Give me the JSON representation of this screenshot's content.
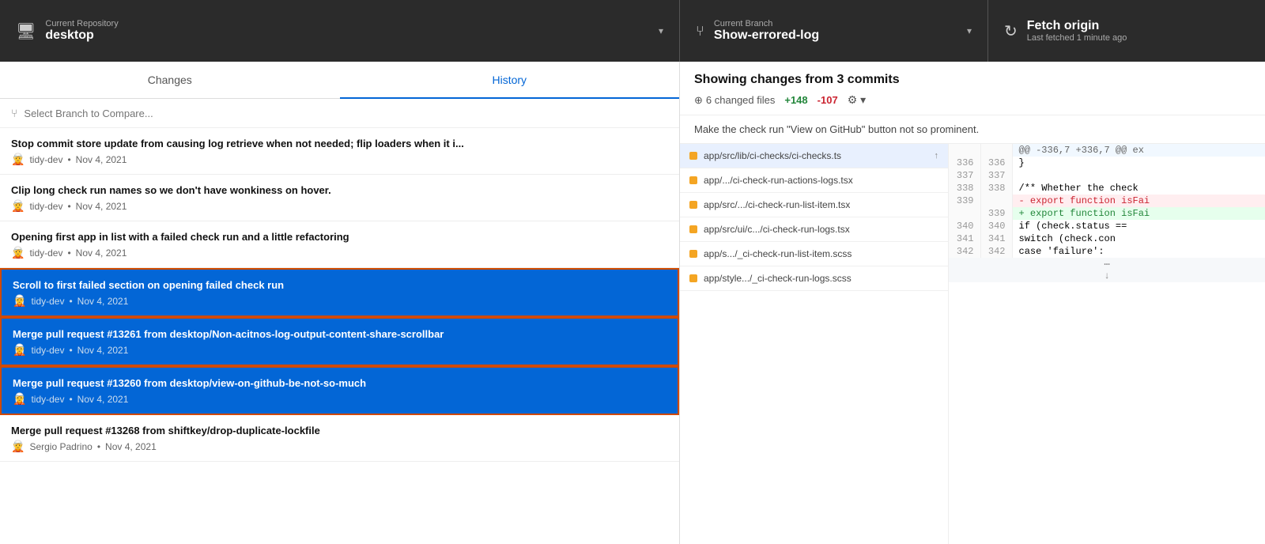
{
  "topBar": {
    "repo": {
      "label": "Current Repository",
      "value": "desktop",
      "icon": "🖥"
    },
    "branch": {
      "label": "Current Branch",
      "value": "Show-errored-log",
      "icon": "⑂"
    },
    "fetch": {
      "label": "Fetch origin",
      "sublabel": "Last fetched 1 minute ago",
      "icon": "↻"
    }
  },
  "tabs": {
    "changes": "Changes",
    "history": "History"
  },
  "branchCompare": {
    "placeholder": "Select Branch to Compare...",
    "icon": "⑂"
  },
  "commits": [
    {
      "id": 1,
      "title": "Stop commit store update from causing log retrieve when not needed; flip loaders when it i...",
      "author": "tidy-dev",
      "date": "Nov 4, 2021",
      "selected": false
    },
    {
      "id": 2,
      "title": "Clip long check run names so we don't have wonkiness on hover.",
      "author": "tidy-dev",
      "date": "Nov 4, 2021",
      "selected": false
    },
    {
      "id": 3,
      "title": "Opening first app in list with a failed check run and a little refactoring",
      "author": "tidy-dev",
      "date": "Nov 4, 2021",
      "selected": false
    },
    {
      "id": 4,
      "title": "Scroll to first failed section on opening failed check run",
      "author": "tidy-dev",
      "date": "Nov 4, 2021",
      "selected": true
    },
    {
      "id": 5,
      "title": "Merge pull request #13261 from desktop/Non-acitnos-log-output-content-share-scrollbar",
      "author": "tidy-dev",
      "date": "Nov 4, 2021",
      "selected": true
    },
    {
      "id": 6,
      "title": "Merge pull request #13260 from desktop/view-on-github-be-not-so-much",
      "author": "tidy-dev",
      "date": "Nov 4, 2021",
      "selected": true
    },
    {
      "id": 7,
      "title": "Merge pull request #13268 from shiftkey/drop-duplicate-lockfile",
      "author": "Sergio Padrino",
      "date": "Nov 4, 2021",
      "selected": false
    }
  ],
  "rightPanel": {
    "title": "Showing changes from 3 commits",
    "changedFiles": "6 changed files",
    "additions": "+148",
    "deletions": "-107",
    "description": "Make the check run \"View on GitHub\" button not so prominent."
  },
  "files": [
    {
      "name": "app/src/lib/ci-checks/ci-checks.ts",
      "active": true,
      "arrow": "↑"
    },
    {
      "name": "app/.../ci-check-run-actions-logs.tsx",
      "active": false
    },
    {
      "name": "app/src/.../ci-check-run-list-item.tsx",
      "active": false
    },
    {
      "name": "app/src/ui/c.../ci-check-run-logs.tsx",
      "active": false
    },
    {
      "name": "app/s.../_ci-check-run-list-item.scss",
      "active": false
    },
    {
      "name": "app/style.../_ci-check-run-logs.scss",
      "active": false
    }
  ],
  "diffLines": [
    {
      "type": "hunk",
      "oldNum": "",
      "newNum": "",
      "content": "@@ -336,7 +336,7 @@ ex"
    },
    {
      "type": "context",
      "oldNum": "336",
      "newNum": "336",
      "content": "  }"
    },
    {
      "type": "context",
      "oldNum": "337",
      "newNum": "337",
      "content": ""
    },
    {
      "type": "context",
      "oldNum": "338",
      "newNum": "338",
      "content": "  /** Whether the check"
    },
    {
      "type": "removed",
      "oldNum": "339",
      "newNum": "",
      "content": "- export function isFai"
    },
    {
      "type": "added",
      "oldNum": "",
      "newNum": "339",
      "content": "+ export function isFai"
    },
    {
      "type": "context",
      "oldNum": "340",
      "newNum": "340",
      "content": "    if (check.status =="
    },
    {
      "type": "context",
      "oldNum": "341",
      "newNum": "341",
      "content": "      switch (check.con"
    },
    {
      "type": "context",
      "oldNum": "342",
      "newNum": "342",
      "content": "        case 'failure':"
    }
  ]
}
